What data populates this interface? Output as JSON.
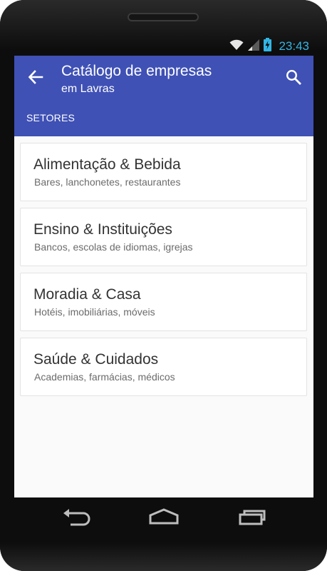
{
  "status_bar": {
    "time": "23:43",
    "icons": [
      "wifi-icon",
      "signal-icon",
      "battery-charging-icon"
    ]
  },
  "app_bar": {
    "title": "Catálogo de empresas",
    "subtitle": "em Lavras",
    "back_icon": "arrow-left-icon",
    "search_icon": "search-icon",
    "tab_label": "SETORES"
  },
  "sectors": [
    {
      "title": "Alimentação & Bebida",
      "subtitle": "Bares, lanchonetes, restaurantes"
    },
    {
      "title": "Ensino & Instituições",
      "subtitle": "Bancos, escolas de idiomas, igrejas"
    },
    {
      "title": "Moradia & Casa",
      "subtitle": "Hotéis, imobiliárias, móveis"
    },
    {
      "title": "Saúde & Cuidados",
      "subtitle": "Academias, farmácias, médicos"
    }
  ],
  "nav_bar": {
    "icons": [
      "nav-back-icon",
      "nav-home-icon",
      "nav-recents-icon"
    ]
  },
  "colors": {
    "primary": "#3f51b5",
    "status_accent": "#33b5e5",
    "background": "#fafafa",
    "card": "#ffffff"
  }
}
